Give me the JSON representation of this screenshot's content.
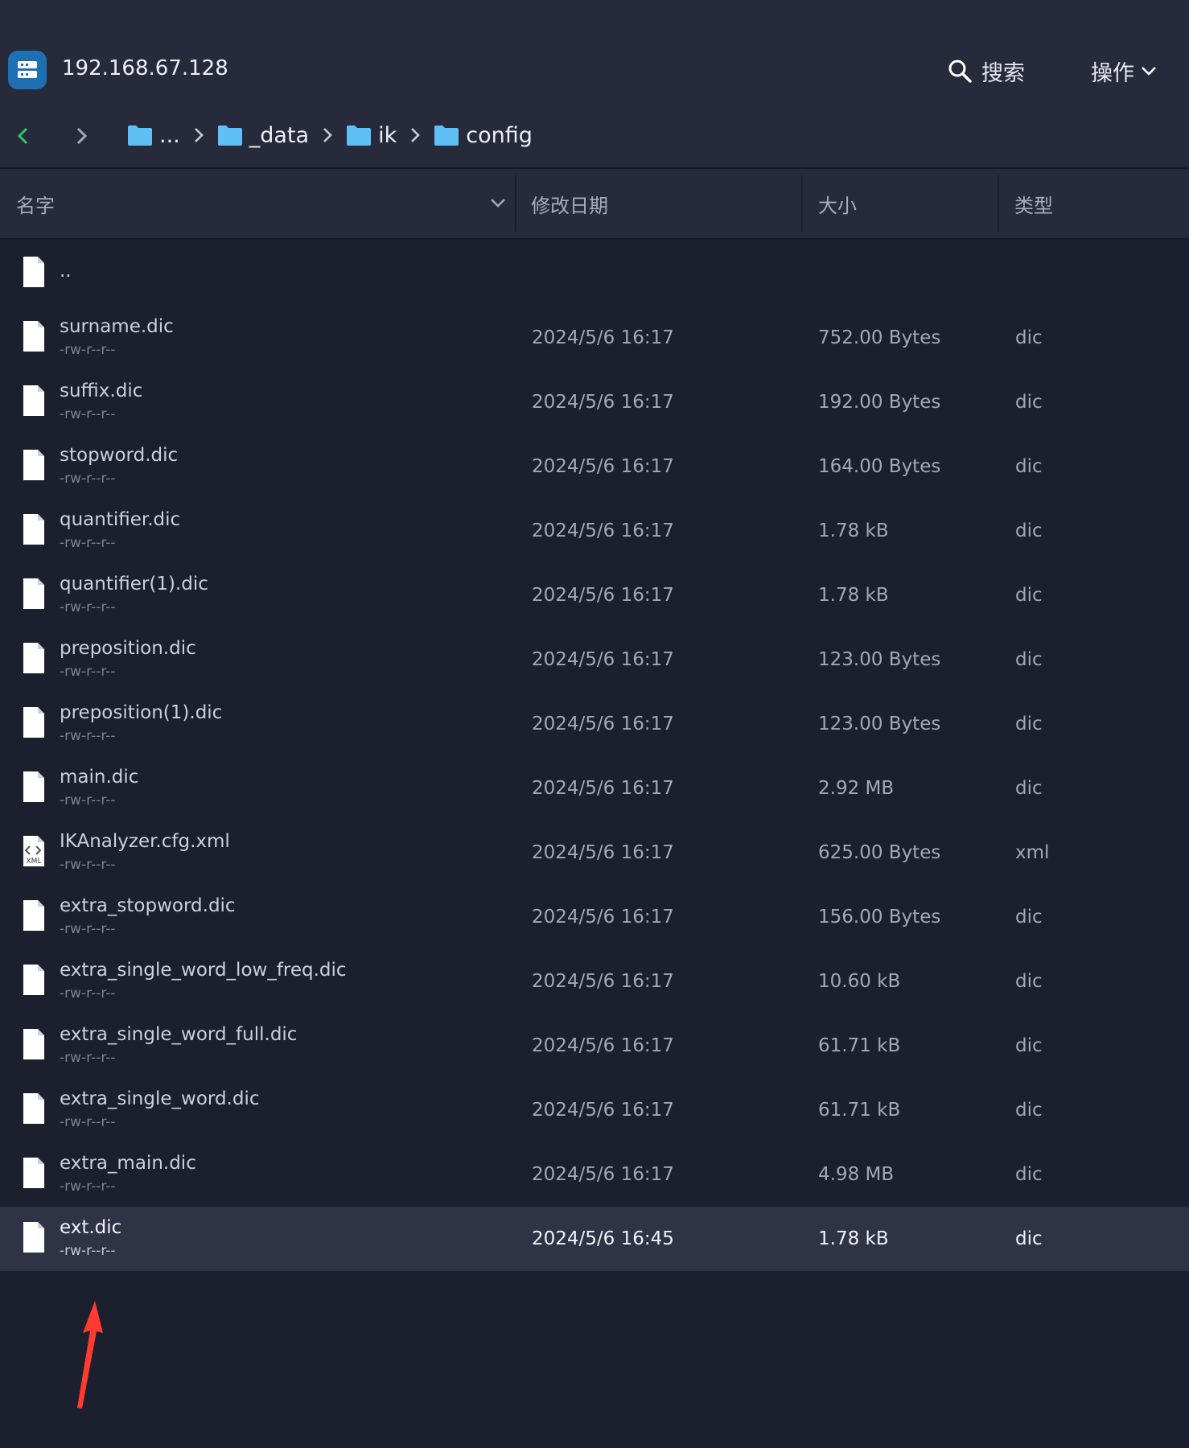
{
  "host": {
    "title": "192.168.67.128",
    "icon": "server-icon"
  },
  "toolbar": {
    "search_label": "搜索",
    "actions_label": "操作"
  },
  "breadcrumb": [
    "...",
    "_data",
    "ik",
    "config"
  ],
  "columns": {
    "name": "名字",
    "modified": "修改日期",
    "size": "大小",
    "type": "类型"
  },
  "parent": {
    "name": ".."
  },
  "files": [
    {
      "name": "surname.dic",
      "perm": "-rw-r--r--",
      "date": "2024/5/6 16:17",
      "size": "752.00 Bytes",
      "type": "dic",
      "icon": "file-icon"
    },
    {
      "name": "suffix.dic",
      "perm": "-rw-r--r--",
      "date": "2024/5/6 16:17",
      "size": "192.00 Bytes",
      "type": "dic",
      "icon": "file-icon"
    },
    {
      "name": "stopword.dic",
      "perm": "-rw-r--r--",
      "date": "2024/5/6 16:17",
      "size": "164.00 Bytes",
      "type": "dic",
      "icon": "file-icon"
    },
    {
      "name": "quantifier.dic",
      "perm": "-rw-r--r--",
      "date": "2024/5/6 16:17",
      "size": "1.78 kB",
      "type": "dic",
      "icon": "file-icon"
    },
    {
      "name": "quantifier(1).dic",
      "perm": "-rw-r--r--",
      "date": "2024/5/6 16:17",
      "size": "1.78 kB",
      "type": "dic",
      "icon": "file-icon"
    },
    {
      "name": "preposition.dic",
      "perm": "-rw-r--r--",
      "date": "2024/5/6 16:17",
      "size": "123.00 Bytes",
      "type": "dic",
      "icon": "file-icon"
    },
    {
      "name": "preposition(1).dic",
      "perm": "-rw-r--r--",
      "date": "2024/5/6 16:17",
      "size": "123.00 Bytes",
      "type": "dic",
      "icon": "file-icon"
    },
    {
      "name": "main.dic",
      "perm": "-rw-r--r--",
      "date": "2024/5/6 16:17",
      "size": "2.92 MB",
      "type": "dic",
      "icon": "file-icon"
    },
    {
      "name": "IKAnalyzer.cfg.xml",
      "perm": "-rw-r--r--",
      "date": "2024/5/6 16:17",
      "size": "625.00 Bytes",
      "type": "xml",
      "icon": "xml-file-icon",
      "icon_text": "XML"
    },
    {
      "name": "extra_stopword.dic",
      "perm": "-rw-r--r--",
      "date": "2024/5/6 16:17",
      "size": "156.00 Bytes",
      "type": "dic",
      "icon": "file-icon"
    },
    {
      "name": "extra_single_word_low_freq.dic",
      "perm": "-rw-r--r--",
      "date": "2024/5/6 16:17",
      "size": "10.60 kB",
      "type": "dic",
      "icon": "file-icon"
    },
    {
      "name": "extra_single_word_full.dic",
      "perm": "-rw-r--r--",
      "date": "2024/5/6 16:17",
      "size": "61.71 kB",
      "type": "dic",
      "icon": "file-icon"
    },
    {
      "name": "extra_single_word.dic",
      "perm": "-rw-r--r--",
      "date": "2024/5/6 16:17",
      "size": "61.71 kB",
      "type": "dic",
      "icon": "file-icon"
    },
    {
      "name": "extra_main.dic",
      "perm": "-rw-r--r--",
      "date": "2024/5/6 16:17",
      "size": "4.98 MB",
      "type": "dic",
      "icon": "file-icon"
    },
    {
      "name": "ext.dic",
      "perm": "-rw-r--r--",
      "date": "2024/5/6 16:45",
      "size": "1.78 kB",
      "type": "dic",
      "icon": "file-icon",
      "selected": true
    }
  ],
  "colors": {
    "accent": "#1f6fb5",
    "folder": "#5fc0f5",
    "annotation": "#ff3b30",
    "back_arrow": "#2fc46f"
  }
}
